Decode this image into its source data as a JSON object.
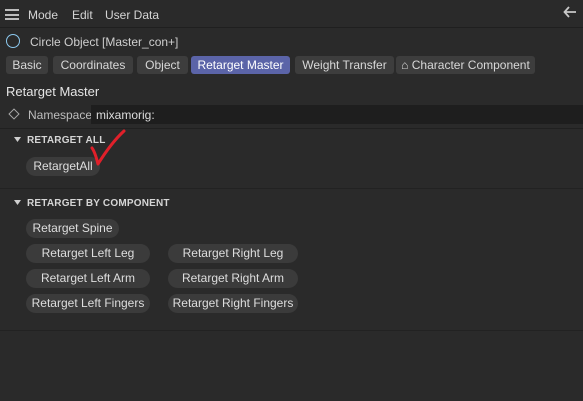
{
  "menubar": {
    "items": [
      "Mode",
      "Edit",
      "User Data"
    ]
  },
  "object": {
    "title": "Circle Object [Master_con+]"
  },
  "tabs": [
    {
      "label": "Basic"
    },
    {
      "label": "Coordinates"
    },
    {
      "label": "Object"
    },
    {
      "label": "Retarget Master",
      "active": true
    },
    {
      "label": "Weight Transfer"
    },
    {
      "label": "⌂ Character Component"
    }
  ],
  "section": {
    "title": "Retarget Master"
  },
  "namespace": {
    "label": "Namespace",
    "value": "mixamorig:"
  },
  "groups": {
    "retarget_all": {
      "title": "RETARGET ALL",
      "button": "RetargetAll"
    },
    "retarget_by_component": {
      "title": "RETARGET BY COMPONENT",
      "spine": "Retarget Spine",
      "left_leg": "Retarget Left Leg",
      "right_leg": "Retarget Right Leg",
      "left_arm": "Retarget Left Arm",
      "right_arm": "Retarget Right Arm",
      "left_fingers": "Retarget Left Fingers",
      "right_fingers": "Retarget Right Fingers"
    }
  },
  "colors": {
    "background": "#2a2a2a",
    "active_tab": "#5b64a8",
    "button": "#3b3b3b",
    "annotation": "#e0202a"
  }
}
